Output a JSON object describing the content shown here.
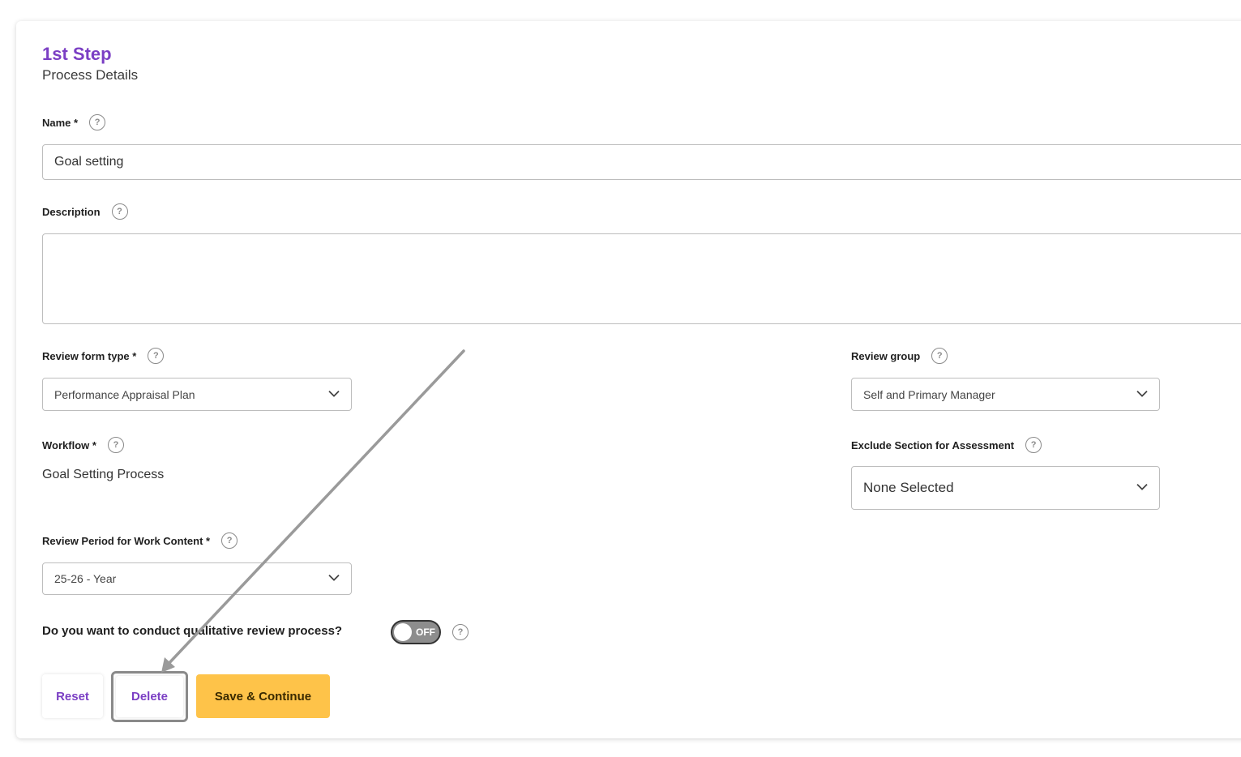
{
  "header": {
    "step": "1st Step",
    "subtitle": "Process Details"
  },
  "fields": {
    "name": {
      "label": "Name *",
      "value": "Goal setting"
    },
    "description": {
      "label": "Description",
      "value": ""
    },
    "review_form_type": {
      "label": "Review form type *",
      "value": "Performance Appraisal Plan"
    },
    "review_group": {
      "label": "Review group",
      "value": "Self and Primary Manager"
    },
    "workflow": {
      "label": "Workflow *",
      "value": "Goal Setting Process"
    },
    "exclude_section": {
      "label": "Exclude Section for Assessment",
      "value": "None Selected"
    },
    "review_period": {
      "label": "Review Period for Work Content *",
      "value": "25-26 - Year"
    },
    "qualitative": {
      "label": "Do you want to conduct qualitative review process?",
      "toggle_state": "OFF"
    }
  },
  "help_glyph": "?",
  "buttons": {
    "reset": "Reset",
    "delete": "Delete",
    "save": "Save & Continue"
  },
  "colors": {
    "accent": "#7b3fc4",
    "primary_button": "#fec349",
    "toggle_off": "#8d8d8d"
  },
  "icons": {
    "help": "question-circle-icon",
    "dropdown": "chevron-down-icon",
    "annotation": "arrow-icon"
  }
}
